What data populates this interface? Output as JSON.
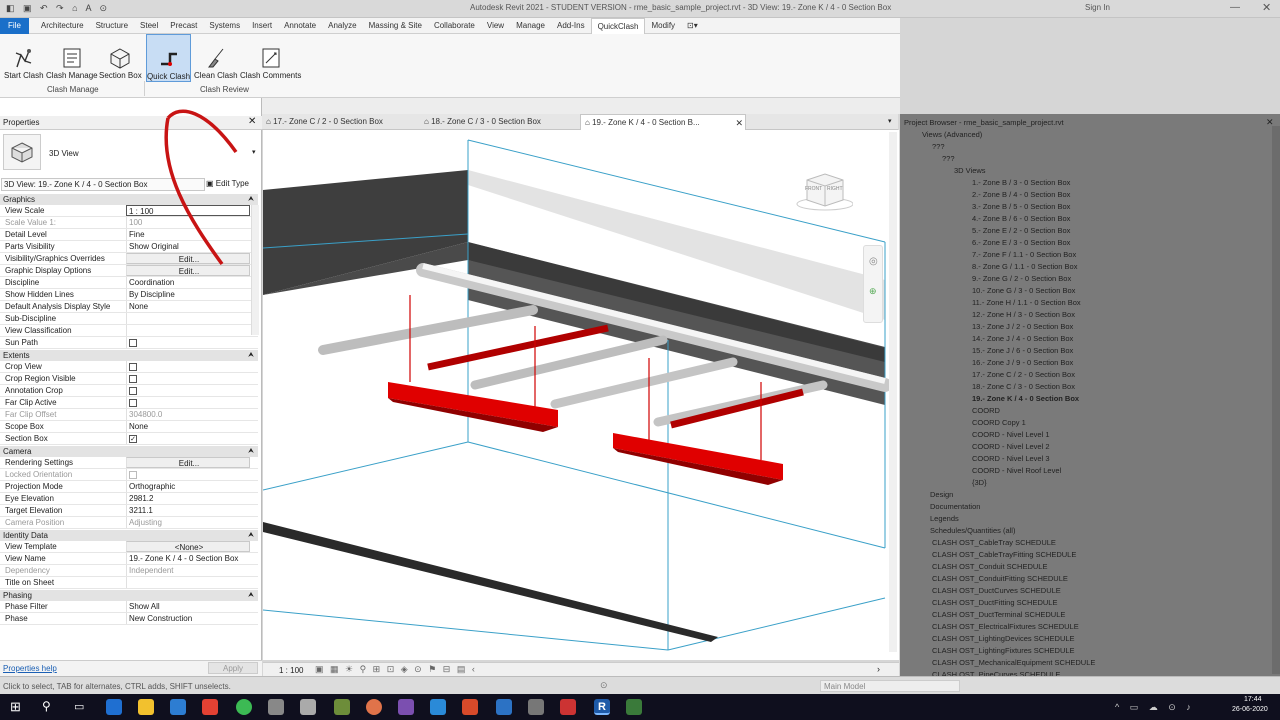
{
  "titlebar": {
    "title": "Autodesk Revit 2021 - STUDENT VERSION - rme_basic_sample_project.rvt - 3D View: 19.- Zone    K / 4 - 0    Section Box",
    "qat": "◧ ▣ ↶ ↷ ⌂ A ⊙",
    "signin": "Sign In"
  },
  "menu": {
    "file": "File",
    "tabs": [
      "Architecture",
      "Structure",
      "Steel",
      "Precast",
      "Systems",
      "Insert",
      "Annotate",
      "Analyze",
      "Massing & Site",
      "Collaborate",
      "View",
      "Manage",
      "Add-Ins",
      "QuickClash",
      "Modify"
    ]
  },
  "ribbon": {
    "tools": [
      {
        "label": "Start Clash",
        "icon": "start-clash-icon"
      },
      {
        "label": "Clash Manage",
        "icon": "clash-manage-icon"
      },
      {
        "label": "Section Box",
        "icon": "section-box-icon"
      },
      {
        "label": "Quick Clash",
        "icon": "quick-clash-icon"
      },
      {
        "label": "Clean Clash",
        "icon": "clean-clash-icon"
      },
      {
        "label": "Clash Comments",
        "icon": "clash-comments-icon"
      }
    ],
    "groups": [
      "Clash Manage",
      "Clash Review"
    ]
  },
  "properties": {
    "title": "Properties",
    "type": "3D View",
    "selector": "3D View: 19.- Zone    K / 4 - 0    Section Box",
    "edit_type": "Edit Type",
    "help": "Properties help",
    "apply": "Apply",
    "sections": {
      "graphics": "Graphics",
      "extents": "Extents",
      "camera": "Camera",
      "identity": "Identity Data",
      "phasing": "Phasing"
    },
    "rows": {
      "view_scale": [
        "View Scale",
        "1 : 100"
      ],
      "scale_value": [
        "Scale Value    1:",
        "100"
      ],
      "detail_level": [
        "Detail Level",
        "Fine"
      ],
      "parts_visibility": [
        "Parts Visibility",
        "Show Original"
      ],
      "vg_overrides": [
        "Visibility/Graphics Overrides",
        "Edit..."
      ],
      "graphic_display": [
        "Graphic Display Options",
        "Edit..."
      ],
      "discipline": [
        "Discipline",
        "Coordination"
      ],
      "hidden_lines": [
        "Show Hidden Lines",
        "By Discipline"
      ],
      "analysis_style": [
        "Default Analysis Display Style",
        "None"
      ],
      "sub_discipline": [
        "Sub-Discipline",
        ""
      ],
      "view_classification": [
        "View Classification",
        ""
      ],
      "sun_path": [
        "Sun Path",
        ""
      ],
      "crop_view": [
        "Crop View",
        ""
      ],
      "crop_region": [
        "Crop Region Visible",
        ""
      ],
      "annotation_crop": [
        "Annotation Crop",
        ""
      ],
      "far_clip": [
        "Far Clip Active",
        ""
      ],
      "far_clip_offset": [
        "Far Clip Offset",
        "304800.0"
      ],
      "scope_box": [
        "Scope Box",
        "None"
      ],
      "section_box": [
        "Section Box",
        "✓"
      ],
      "rendering": [
        "Rendering Settings",
        "Edit..."
      ],
      "locked_orientation": [
        "Locked Orientation",
        ""
      ],
      "projection": [
        "Projection Mode",
        "Orthographic"
      ],
      "eye_elevation": [
        "Eye Elevation",
        "2981.2"
      ],
      "target_elevation": [
        "Target Elevation",
        "3211.1"
      ],
      "camera_position": [
        "Camera Position",
        "Adjusting"
      ],
      "view_template": [
        "View Template",
        "<None>"
      ],
      "view_name": [
        "View Name",
        "19.- Zone    K / 4 - 0    Section Box"
      ],
      "dependency": [
        "Dependency",
        "Independent"
      ],
      "title_on_sheet": [
        "Title on Sheet",
        ""
      ],
      "phase_filter": [
        "Phase Filter",
        "Show All"
      ],
      "phase": [
        "Phase",
        "New Construction"
      ]
    }
  },
  "viewtabs": [
    {
      "label": "17.- Zone    C / 2 - 0       Section Box"
    },
    {
      "label": "18.- Zone    C / 3 - 0       Section Box"
    },
    {
      "label": "19.- Zone    K / 4 - 0       Section B..."
    }
  ],
  "viewcube": {
    "front": "FRONT",
    "right": "RIGHT"
  },
  "view_status": {
    "scale": "1 : 100"
  },
  "browser": {
    "title": "Project Browser - rme_basic_sample_project.rvt",
    "root": "Views (Advanced)",
    "q1": "???",
    "q2": "???",
    "views3d": "3D Views",
    "items": [
      "1.- Zone    B / 3 - 0      Section Box",
      "2.- Zone    B / 4 - 0      Section Box",
      "3.- Zone    B / 5 - 0      Section Box",
      "4.- Zone    B / 6 - 0      Section Box",
      "5.- Zone    E / 2 - 0      Section Box",
      "6.- Zone    E / 3 - 0      Section Box",
      "7.- Zone    F / 1.1 - 0     Section Box",
      "8.- Zone    G / 1.1 - 0     Section Box",
      "9.- Zone    G / 2 - 0      Section Box",
      "10.- Zone    G / 3 - 0      Section Box",
      "11.- Zone    H / 1.1 - 0     Section Box",
      "12.- Zone    H / 3 - 0      Section Box",
      "13.- Zone    J / 2 - 0      Section Box",
      "14.- Zone    J / 4 - 0      Section Box",
      "15.- Zone    J / 6 - 0      Section Box",
      "16.- Zone    J / 9 - 0      Section Box",
      "17.- Zone    C / 2 - 0      Section Box",
      "18.- Zone    C / 3 - 0      Section Box",
      "19.- Zone    K / 4 - 0      Section Box",
      "COORD",
      "COORD   Copy 1",
      "COORD - Nivel Level 1",
      "COORD - Nivel Level 2",
      "COORD - Nivel Level 3",
      "COORD - Nivel Roof Level",
      "{3D}"
    ],
    "groups": [
      "Design",
      "Documentation",
      "Legends",
      "Schedules/Quantities (all)"
    ],
    "schedules": [
      "CLASH OST_CableTray SCHEDULE",
      "CLASH OST_CableTrayFitting SCHEDULE",
      "CLASH OST_Conduit SCHEDULE",
      "CLASH OST_ConduitFitting SCHEDULE",
      "CLASH OST_DuctCurves SCHEDULE",
      "CLASH OST_DuctFitting SCHEDULE",
      "CLASH OST_DuctTerminal SCHEDULE",
      "CLASH OST_ElectricalFixtures SCHEDULE",
      "CLASH OST_LightingDevices SCHEDULE",
      "CLASH OST_LightingFixtures SCHEDULE",
      "CLASH OST_MechanicalEquipment SCHEDULE",
      "CLASH OST_PipeCurves SCHEDULE"
    ]
  },
  "statusbar": {
    "hint": "Click to select, TAB for alternates, CTRL adds, SHIFT unselects.",
    "model": "Main Model"
  },
  "taskbar": {
    "time": "17:44",
    "date": "26-06-2020"
  },
  "colors": {
    "accent": "#1a6fc9",
    "clash": "#e00000",
    "section_box": "#3aa0c8"
  }
}
